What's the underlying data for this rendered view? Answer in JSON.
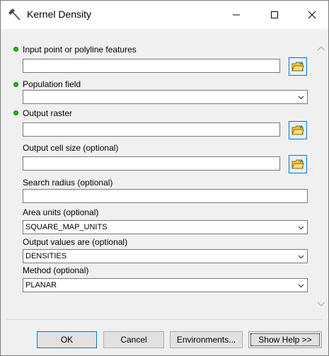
{
  "window": {
    "title": "Kernel Density"
  },
  "fields": {
    "input_features": {
      "label": "Input point or polyline features",
      "value": ""
    },
    "population_field": {
      "label": "Population field",
      "value": ""
    },
    "output_raster": {
      "label": "Output raster",
      "value": ""
    },
    "cell_size": {
      "label": "Output cell size (optional)",
      "value": ""
    },
    "search_radius": {
      "label": "Search radius (optional)",
      "value": ""
    },
    "area_units": {
      "label": "Area units (optional)",
      "value": "SQUARE_MAP_UNITS"
    },
    "output_values": {
      "label": "Output values are (optional)",
      "value": "DENSITIES"
    },
    "method": {
      "label": "Method (optional)",
      "value": "PLANAR"
    }
  },
  "buttons": {
    "ok": "OK",
    "cancel": "Cancel",
    "environments": "Environments...",
    "show_help": "Show Help >>"
  },
  "colors": {
    "required_dot": "#2bb31e",
    "focus_border": "#0078d7"
  },
  "icons": {
    "title": "hammer-icon",
    "browse": "open-folder-icon",
    "minimize": "minimize-icon",
    "maximize": "maximize-icon",
    "close": "close-icon"
  }
}
